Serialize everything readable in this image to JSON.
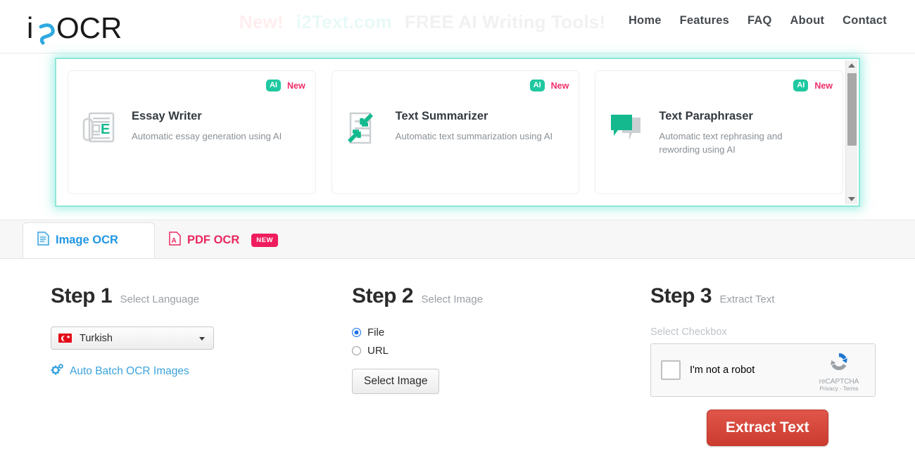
{
  "header": {
    "logo_text": "i2OCR",
    "promo": {
      "new_label": "New!",
      "site": "i2Text.com",
      "rest": "FREE AI Writing Tools!"
    },
    "nav": [
      {
        "label": "Home"
      },
      {
        "label": "Features"
      },
      {
        "label": "FAQ"
      },
      {
        "label": "About"
      },
      {
        "label": "Contact"
      }
    ]
  },
  "carousel": {
    "cards": [
      {
        "badge_ai": "AI",
        "badge_new": "New",
        "title": "Essay Writer",
        "desc": "Automatic essay generation using AI",
        "icon": "newspaper-e-icon"
      },
      {
        "badge_ai": "AI",
        "badge_new": "New",
        "title": "Text Summarizer",
        "desc": "Automatic text summarization using AI",
        "icon": "document-arrows-icon"
      },
      {
        "badge_ai": "AI",
        "badge_new": "New",
        "title": "Text Paraphraser",
        "desc": "Automatic text rephrasing and rewording using AI",
        "icon": "speech-bubbles-icon"
      }
    ]
  },
  "tabs": [
    {
      "label": "Image OCR",
      "icon": "document-icon",
      "active": true
    },
    {
      "label": "PDF OCR",
      "icon": "pdf-icon",
      "badge": "NEW",
      "active": false
    }
  ],
  "steps": {
    "step1": {
      "num": "Step 1",
      "sub": "Select Language",
      "language": "Turkish",
      "batch_link": "Auto Batch OCR Images"
    },
    "step2": {
      "num": "Step 2",
      "sub": "Select Image",
      "radio_file": "File",
      "radio_url": "URL",
      "select_button": "Select Image"
    },
    "step3": {
      "num": "Step 3",
      "sub": "Extract Text",
      "checkbox_label": "Select Checkbox",
      "recaptcha_text": "I'm not a robot",
      "recaptcha_brand": "reCAPTCHA",
      "recaptcha_legal": "Privacy - Terms",
      "extract_button": "Extract Text"
    }
  },
  "colors": {
    "accent_blue": "#2196e3",
    "accent_pink": "#ef1d5e",
    "accent_teal": "#1fc8a0",
    "glow": "#5ae2cd",
    "extract_red": "#cc3b2f"
  }
}
